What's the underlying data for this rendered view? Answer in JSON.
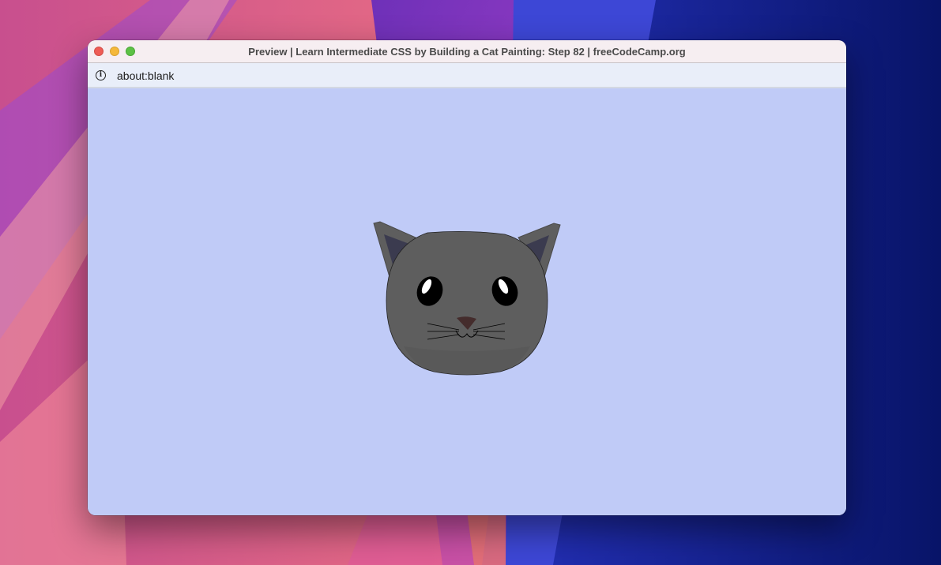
{
  "window": {
    "title": "Preview | Learn Intermediate CSS by Building a Cat Painting: Step 82 | freeCodeCamp.org"
  },
  "addressbar": {
    "url": "about:blank"
  },
  "colors": {
    "canvas_background": "#c0cbf7",
    "cat_head": "#5e5e5e",
    "cat_ear_outer": "#5e5e5e",
    "cat_ear_inner": "#3b3b4f",
    "cat_eye": "#000000",
    "cat_nose": "#442c2c"
  },
  "icons": {
    "close": "close-icon",
    "minimize": "minimize-icon",
    "zoom": "zoom-icon",
    "info": "info-icon"
  }
}
